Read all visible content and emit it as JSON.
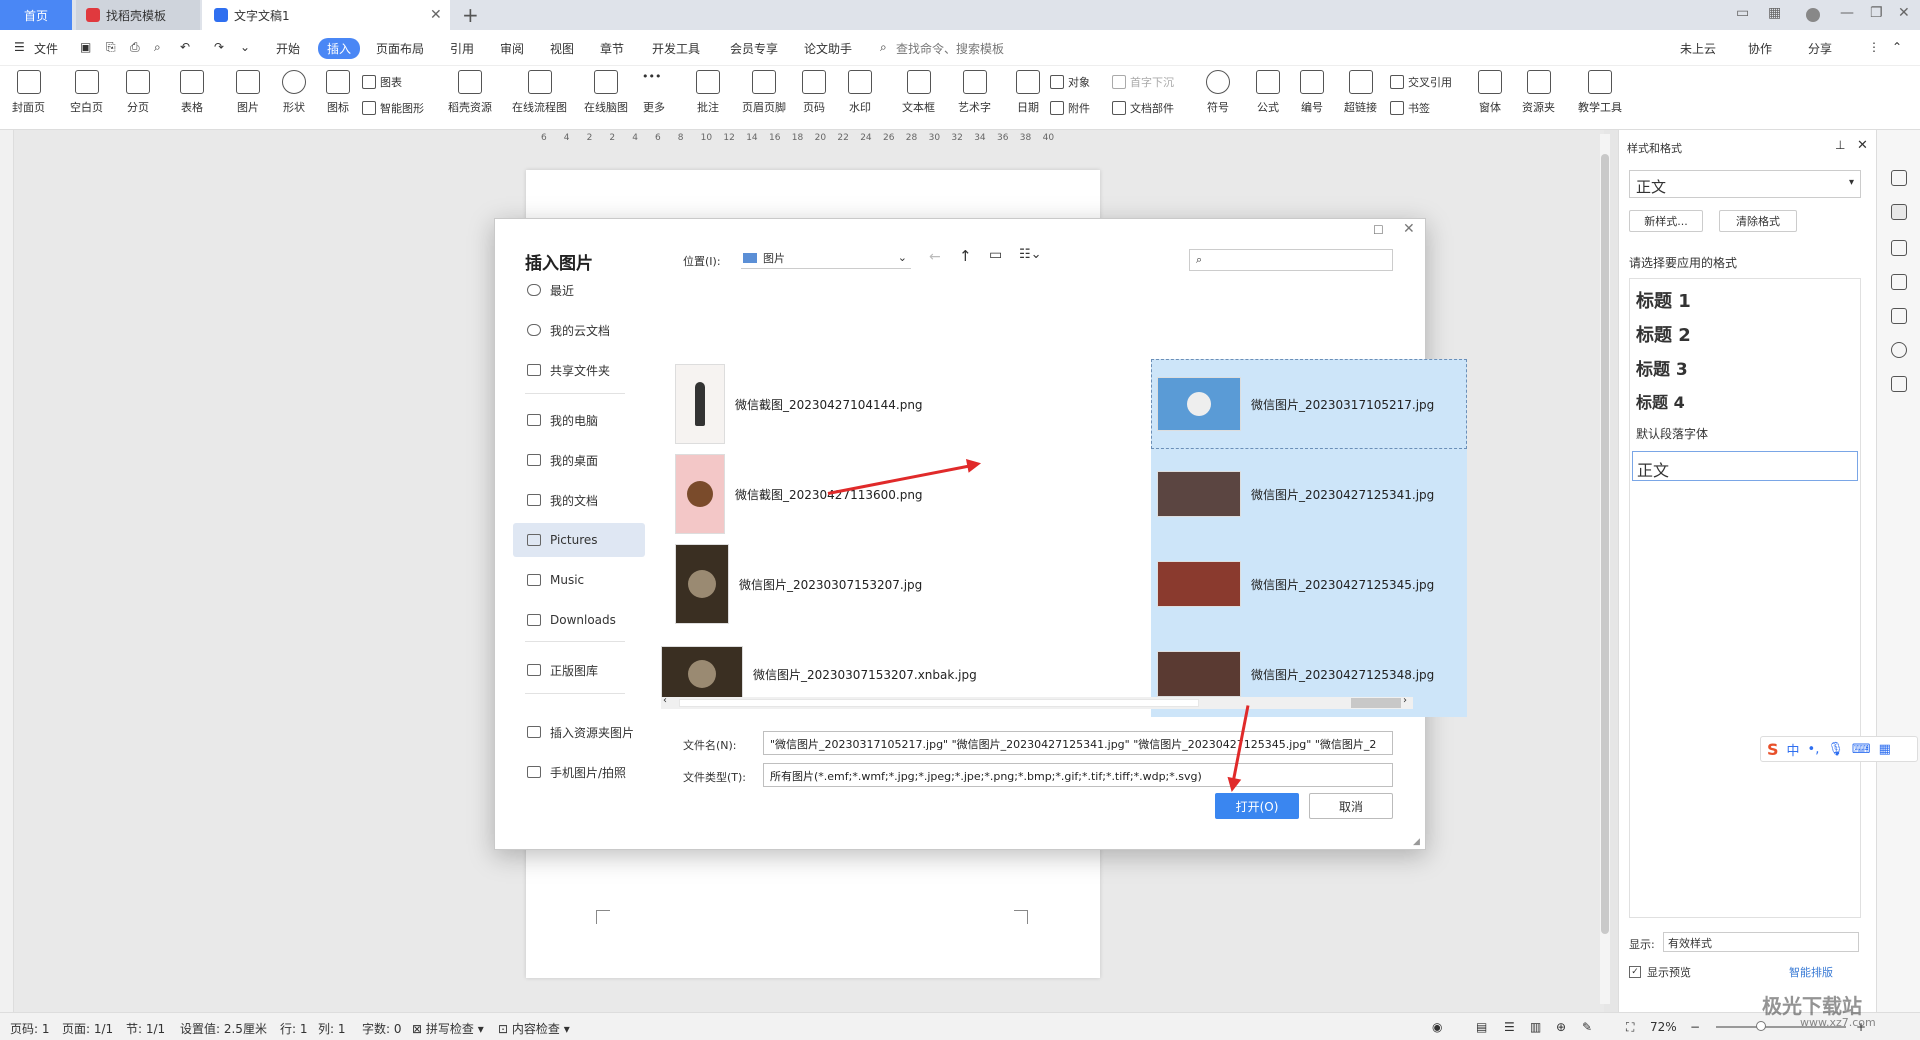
{
  "tabs": {
    "home": "首页",
    "template": "找稻壳模板",
    "doc": "文字文稿1"
  },
  "menu": [
    "文件",
    "开始",
    "插入",
    "页面布局",
    "引用",
    "审阅",
    "视图",
    "章节",
    "开发工具",
    "会员专享",
    "论文助手"
  ],
  "search_placeholder": "查找命令、搜索模板",
  "top_right": {
    "cloud": "未上云",
    "collab": "协作",
    "share": "分享"
  },
  "ribbon": {
    "cover": "封面页",
    "blank": "空白页",
    "pagebreak": "分页",
    "table": "表格",
    "picture": "图片",
    "shape": "形状",
    "icon": "图标",
    "chart": "图表",
    "smart": "智能图形",
    "daoke": "稻壳资源",
    "flow": "在线流程图",
    "mind": "在线脑图",
    "more": "更多",
    "comment": "批注",
    "header": "页眉页脚",
    "pagenum": "页码",
    "watermark": "水印",
    "textbox": "文本框",
    "art": "艺术字",
    "date": "日期",
    "object": "对象",
    "attach": "附件",
    "dropcap": "首字下沉",
    "docpart": "文档部件",
    "symbol": "符号",
    "formula": "公式",
    "number": "编号",
    "hyperlink": "超链接",
    "crossref": "交叉引用",
    "bookmark": "书签",
    "window": "窗体",
    "res": "资源夹",
    "teach": "教学工具"
  },
  "ruler": [
    "6",
    "4",
    "2",
    "2",
    "4",
    "6",
    "8",
    "10",
    "12",
    "14",
    "16",
    "18",
    "20",
    "22",
    "24",
    "26",
    "28",
    "30",
    "32",
    "34",
    "36",
    "38",
    "40"
  ],
  "panel": {
    "title": "样式和格式",
    "current": "正文",
    "new_style": "新样式...",
    "clear": "清除格式",
    "hint": "请选择要应用的格式",
    "styles": [
      "标题 1",
      "标题 2",
      "标题 3",
      "标题 4",
      "默认段落字体",
      "正文"
    ],
    "show_label": "显示:",
    "show_value": "有效样式",
    "preview": "显示预览",
    "smart": "智能排版"
  },
  "status": {
    "page": "页码: 1",
    "pages": "页面: 1/1",
    "section": "节: 1/1",
    "setting": "设置值: 2.5厘米",
    "row": "行: 1",
    "col": "列: 1",
    "words": "字数: 0",
    "spell": "拼写检查",
    "content": "内容检查",
    "zoom": "72%"
  },
  "dialog": {
    "title": "插入图片",
    "location_label": "位置(I):",
    "location_value": "图片",
    "nav": [
      "最近",
      "我的云文档",
      "共享文件夹",
      "我的电脑",
      "我的桌面",
      "我的文档",
      "Pictures",
      "Music",
      "Downloads",
      "正版图库",
      "插入资源夹图片",
      "手机图片/拍照"
    ],
    "files_left": [
      "微信截图_20230427104144.png",
      "微信截图_20230427113600.png",
      "微信图片_20230307153207.jpg",
      "微信图片_20230307153207.xnbak.jpg"
    ],
    "files_right": [
      "微信图片_20230317105217.jpg",
      "微信图片_20230427125341.jpg",
      "微信图片_20230427125345.jpg",
      "微信图片_20230427125348.jpg"
    ],
    "filename_label": "文件名(N):",
    "filename_value": "\"微信图片_20230317105217.jpg\" \"微信图片_20230427125341.jpg\" \"微信图片_20230427125345.jpg\" \"微信图片_2",
    "filetype_label": "文件类型(T):",
    "filetype_value": "所有图片(*.emf;*.wmf;*.jpg;*.jpeg;*.jpe;*.png;*.bmp;*.gif;*.tif;*.tiff;*.wdp;*.svg)",
    "open": "打开(O)",
    "cancel": "取消"
  },
  "ime": {
    "lang": "中"
  },
  "watermark": "极光下载站",
  "watermark_url": "www.xz7.com"
}
